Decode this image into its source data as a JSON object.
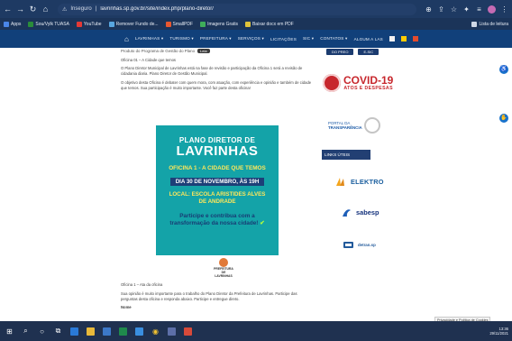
{
  "browser": {
    "url_insecure_label": "Inseguro",
    "url": "lavrinhas.sp.gov.br/site/index.php/plano-diretor/",
    "bookmarks": [
      {
        "label": "Apps",
        "color": "#4a86e8"
      },
      {
        "label": "Sou/Vylk TUASA",
        "color": "#2a8c3a"
      },
      {
        "label": "YouTube",
        "color": "#e53935"
      },
      {
        "label": "Remover Fundo de...",
        "color": "#58a6e0"
      },
      {
        "label": "SmallPDF",
        "color": "#e8572f"
      },
      {
        "label": "Imagens Gratis",
        "color": "#3fae5a"
      },
      {
        "label": "Baixar docx em PDF",
        "color": "#e0c33a"
      }
    ],
    "bookmarks_right": "Lista de leitura"
  },
  "site_nav": {
    "items": [
      "LAVRINHAS ▾",
      "TURISMO ▾",
      "PREFEITURA ▾",
      "SERVIÇOS ▾",
      "LICITAÇÕES",
      "SIC ▾",
      "CONTATOS ▾",
      "ALGUM A LAS"
    ]
  },
  "content": {
    "crumb": "Produto do Programa de Gestão do Plano",
    "crumb_pill": "Leia",
    "p1_heading": "Oficina 01 – A Cidade que temos",
    "p1": "O Plano Diretor Municipal de Lavrinhas está na fase de revisão e participação da Oficina 1 será a revisão de cidadania diaria. Plano Diretor de Gestão Municipal.",
    "p2": "O objetivo desta Oficina é debater com quem mora, com atuação, com experiência e opinião e também de cidade que temos. Sua participação é muito importante. Você faz parte desta oficina!",
    "footer_heading": "Oficina 1 – Ata da oficina",
    "footer_p": "Sua opinião é muito importante para o trabalho do Plano Diretor da Prefeitura de Lavrinhas. Participe das perguntas desta oficina e responda abaixo. Participe e entregue direto.",
    "footer_label": "Nome"
  },
  "banner": {
    "line1": "PLANO DIRETOR DE",
    "line2": "LAVRINHAS",
    "line3": "OFICINA 1 - A CIDADE QUE TEMOS",
    "line4": "DIA 30 DE NOVEMBRO, ÀS 19H",
    "line5a": "LOCAL: ESCOLA ARISTIDES ALVES",
    "line5b": "DE ANDRADE",
    "line6a": "Participe e contribua com a",
    "line6b": "transformação da nossa cidade!",
    "check": "✔",
    "logo_text_1": "PREFEITURA DE",
    "logo_text_2": "LAVRINHAS"
  },
  "sidebar": {
    "btn1": "DO PREO",
    "btn2": "E-SIC",
    "covid_title": "COVID-19",
    "covid_sub": "ATOS E DESPESAS",
    "portal_1": "PORTAL DA",
    "portal_2": "TRANSPARÊNCIA",
    "utils_label": "LINKS ÚTEIS",
    "elektro": "ELEKTRO",
    "sabesp": "sabesp",
    "detran": "detran.sp"
  },
  "taskbar": {
    "time": "13:36",
    "date": "29/11/2021",
    "tooltip": "Privacidade e Política de Cookies"
  },
  "colors": {
    "banner_teal": "#14a3a8",
    "nav_blue": "#11407a",
    "covid_red": "#c7272d"
  }
}
